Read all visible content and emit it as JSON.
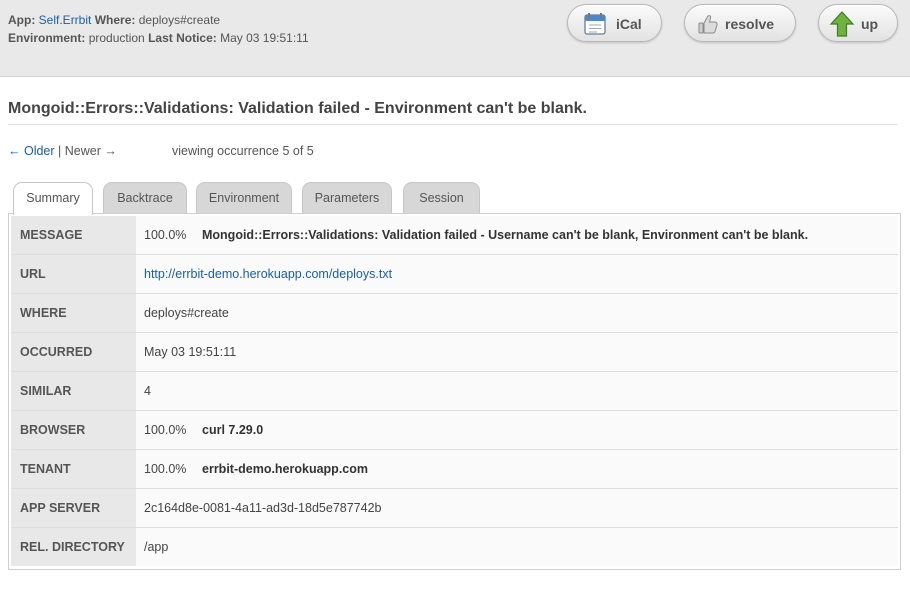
{
  "header": {
    "app_label": "App:",
    "app_name": "Self.Errbit",
    "where_label": "Where:",
    "where_value": "deploys#create",
    "env_label": "Environment:",
    "env_value": "production",
    "last_notice_label": "Last Notice:",
    "last_notice_value": "May 03 19:51:11"
  },
  "actions": {
    "ical": "iCal",
    "resolve": "resolve",
    "up": "up"
  },
  "title": "Mongoid::Errors::Validations: Validation failed - Environment can't be blank.",
  "pager": {
    "older": "← Older",
    "separator": "|",
    "newer": "Newer →",
    "viewing": "viewing occurrence 5 of 5"
  },
  "tabs": [
    "Summary",
    "Backtrace",
    "Environment",
    "Parameters",
    "Session"
  ],
  "summary": {
    "message": {
      "label": "MESSAGE",
      "pct": "100.0%",
      "value": "Mongoid::Errors::Validations: Validation failed - Username can't be blank, Environment can't be blank."
    },
    "url": {
      "label": "URL",
      "value": "http://errbit-demo.herokuapp.com/deploys.txt"
    },
    "where": {
      "label": "WHERE",
      "value": "deploys#create"
    },
    "occurred": {
      "label": "OCCURRED",
      "value": "May 03 19:51:11"
    },
    "similar": {
      "label": "SIMILAR",
      "value": "4"
    },
    "browser": {
      "label": "BROWSER",
      "pct": "100.0%",
      "value": "curl 7.29.0"
    },
    "tenant": {
      "label": "TENANT",
      "pct": "100.0%",
      "value": "errbit-demo.herokuapp.com"
    },
    "app_server": {
      "label": "APP SERVER",
      "value": "2c164d8e-0081-4a11-ad3d-18d5e787742b"
    },
    "rel_directory": {
      "label": "REL. DIRECTORY",
      "value": "/app"
    }
  },
  "colors": {
    "link": "#1a5ea8",
    "up_arrow": "#6db33f"
  }
}
